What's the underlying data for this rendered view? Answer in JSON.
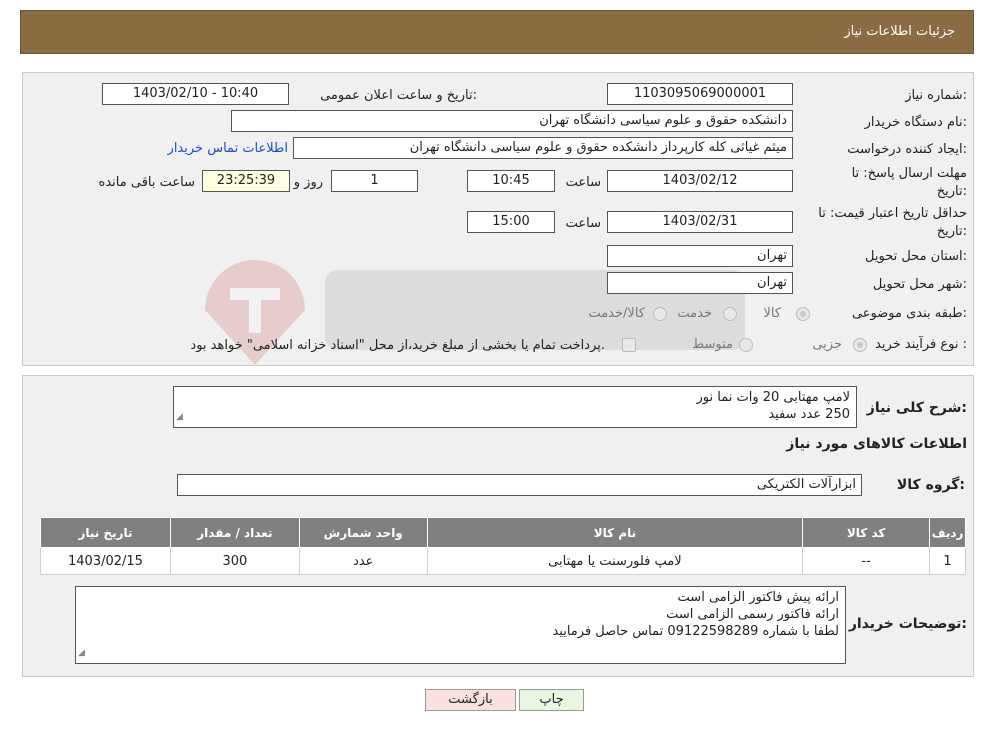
{
  "header": {
    "title": "جزئیات اطلاعات نیاز"
  },
  "form": {
    "need_number": {
      "label": "شماره نیاز:",
      "value": "1103095069000001"
    },
    "announce": {
      "label": "تاریخ و ساعت اعلان عمومی:",
      "value": "1403/02/10 - 10:40"
    },
    "buyer_org": {
      "label": "نام دستگاه خریدار:",
      "value": "دانشکده حقوق و علوم سیاسی دانشگاه تهران"
    },
    "requester": {
      "label": "ایجاد کننده درخواست:",
      "value": "میثم غیاثی کله کارپرداز دانشکده حقوق و علوم سیاسی دانشگاه تهران",
      "contact_link": "اطلاعات تماس خریدار"
    },
    "deadline": {
      "label_line1": "مهلت ارسال پاسخ: تا",
      "label_line2": "تاریخ:",
      "date": "1403/02/12",
      "time_label": "ساعت",
      "time": "10:45",
      "days": "1",
      "days_label": "روز و",
      "remaining": "23:25:39",
      "remaining_label": "ساعت باقی مانده"
    },
    "validity": {
      "label_line1": "حداقل تاریخ اعتبار قیمت: تا",
      "label_line2": "تاریخ:",
      "date": "1403/02/31",
      "time_label": "ساعت",
      "time": "15:00"
    },
    "province": {
      "label": "استان محل تحویل:",
      "value": "تهران"
    },
    "city": {
      "label": "شهر محل تحویل:",
      "value": "تهران"
    },
    "category": {
      "label": "طبقه بندی موضوعی:",
      "options": [
        "کالا",
        "خدمت",
        "کالا/خدمت"
      ]
    },
    "process": {
      "label": "نوع فرآیند خرید :",
      "options": [
        "جزیی",
        "متوسط"
      ],
      "note": "پرداخت تمام یا بخشی از مبلغ خرید،از محل \"اسناد خزانه اسلامی\" خواهد بود."
    }
  },
  "details": {
    "summary_label": "شرح کلی نیاز:",
    "summary_lines": [
      "لامپ مهتابی 20 وات نما نور",
      "250 عدد سفید"
    ],
    "goods_title": "اطلاعات کالاهای مورد نیاز",
    "group_label": "گروه کالا:",
    "group_value": "ابزارآلات الکتریکی",
    "table": {
      "headers": [
        "ردیف",
        "کد کالا",
        "نام کالا",
        "واحد شمارش",
        "تعداد / مقدار",
        "تاریخ نیاز"
      ],
      "rows": [
        [
          "1",
          "--",
          "لامپ فلورسنت یا مهتابی",
          "عدد",
          "300",
          "1403/02/15"
        ]
      ]
    },
    "buyer_notes_label": "توضیحات خریدار:",
    "buyer_notes_lines": [
      "ارائه پیش فاکتور الزامی است",
      "ارائه فاکتور رسمی الزامی است",
      "لطفا با شماره 09122598289 تماس حاصل فرمایید"
    ]
  },
  "buttons": {
    "print": "چاپ",
    "back": "بازگشت"
  }
}
